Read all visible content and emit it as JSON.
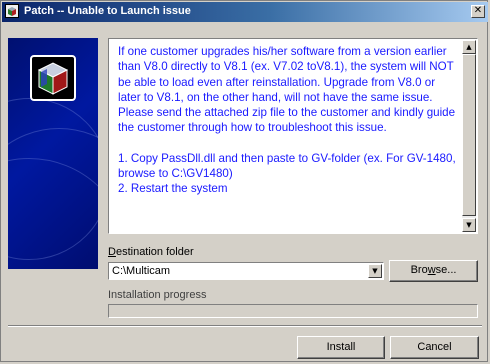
{
  "window": {
    "title": "Patch -- Unable to Launch issue",
    "close_symbol": "✕"
  },
  "message": {
    "paragraph": "If one customer upgrades his/her software from a version earlier than V8.0 directly to V8.1 (ex. V7.02 toV8.1), the system will NOT be able to load even after reinstallation. Upgrade from V8.0 or later to V8.1, on the other hand, will not have the same issue. Please send the attached zip file to the customer and kindly guide the customer through how to troubleshoot this issue.",
    "step1": "1. Copy PassDll.dll and then paste to GV-folder (ex. For GV-1480, browse to C:\\GV1480)",
    "step2": "2. Restart the system"
  },
  "destination": {
    "label_first": "D",
    "label_rest": "estination folder",
    "value": "C:\\Multicam",
    "browse_first": "Bro",
    "browse_underlined": "w",
    "browse_rest": "se..."
  },
  "progress": {
    "label": "Installation progress",
    "fraction": 0
  },
  "buttons": {
    "install": "Install",
    "cancel": "Cancel"
  },
  "scroll": {
    "up_symbol": "▲",
    "down_symbol": "▼"
  },
  "colors": {
    "title_start": "#0a246a",
    "title_end": "#a6caf0",
    "message_text": "#1a1aff",
    "side_panel": "#0018a0"
  },
  "icons": {
    "title": "setup-box-icon",
    "logo": "setup-box-icon"
  }
}
